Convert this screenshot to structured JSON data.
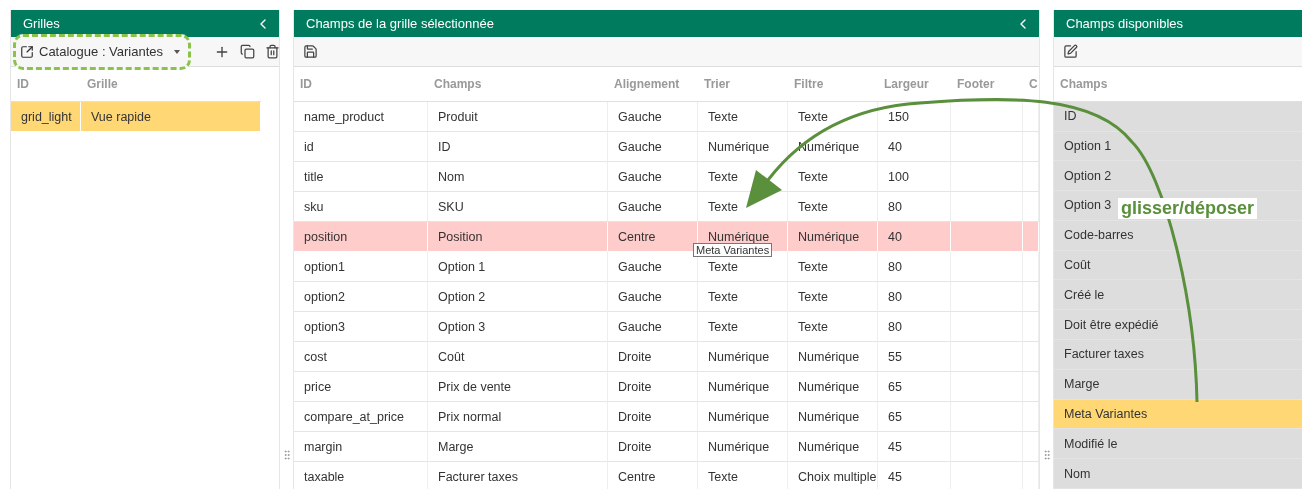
{
  "grids_panel": {
    "title": "Grilles",
    "selector": {
      "label": "Catalogue : Variantes"
    },
    "columns": [
      "ID",
      "Grille"
    ],
    "rows": [
      {
        "id": "grid_light",
        "name": "Vue rapide",
        "selected": true
      }
    ]
  },
  "fields_panel": {
    "title": "Champs de la grille sélectionnée",
    "columns": [
      "ID",
      "Champs",
      "Alignement",
      "Trier",
      "Filtre",
      "Largeur",
      "Footer",
      "C"
    ],
    "rows": [
      {
        "cells": [
          "name_product",
          "Produit",
          "Gauche",
          "Texte",
          "Texte",
          "150"
        ],
        "selected": false
      },
      {
        "cells": [
          "id",
          "ID",
          "Gauche",
          "Numérique",
          "Numérique",
          "40"
        ],
        "selected": false
      },
      {
        "cells": [
          "title",
          "Nom",
          "Gauche",
          "Texte",
          "Texte",
          "100"
        ],
        "selected": false
      },
      {
        "cells": [
          "sku",
          "SKU",
          "Gauche",
          "Texte",
          "Texte",
          "80"
        ],
        "selected": false
      },
      {
        "cells": [
          "position",
          "Position",
          "Centre",
          "Numérique",
          "Numérique",
          "40"
        ],
        "selected": true
      },
      {
        "cells": [
          "option1",
          "Option 1",
          "Gauche",
          "Texte",
          "Texte",
          "80"
        ],
        "selected": false
      },
      {
        "cells": [
          "option2",
          "Option 2",
          "Gauche",
          "Texte",
          "Texte",
          "80"
        ],
        "selected": false
      },
      {
        "cells": [
          "option3",
          "Option 3",
          "Gauche",
          "Texte",
          "Texte",
          "80"
        ],
        "selected": false
      },
      {
        "cells": [
          "cost",
          "Coût",
          "Droite",
          "Numérique",
          "Numérique",
          "55"
        ],
        "selected": false
      },
      {
        "cells": [
          "price",
          "Prix de vente",
          "Droite",
          "Numérique",
          "Numérique",
          "65"
        ],
        "selected": false
      },
      {
        "cells": [
          "compare_at_price",
          "Prix normal",
          "Droite",
          "Numérique",
          "Numérique",
          "65"
        ],
        "selected": false
      },
      {
        "cells": [
          "margin",
          "Marge",
          "Droite",
          "Numérique",
          "Numérique",
          "45"
        ],
        "selected": false
      },
      {
        "cells": [
          "taxable",
          "Facturer taxes",
          "Centre",
          "Texte",
          "Choix multiple",
          "45"
        ],
        "selected": false
      }
    ]
  },
  "available_panel": {
    "title": "Champs disponibles",
    "column": "Champs",
    "items": [
      {
        "label": "ID",
        "selected": false
      },
      {
        "label": "Option 1",
        "selected": false
      },
      {
        "label": "Option 2",
        "selected": false
      },
      {
        "label": "Option 3",
        "selected": false
      },
      {
        "label": "Code-barres",
        "selected": false
      },
      {
        "label": "Coût",
        "selected": false
      },
      {
        "label": "Créé le",
        "selected": false
      },
      {
        "label": "Doit être expédié",
        "selected": false
      },
      {
        "label": "Facturer taxes",
        "selected": false
      },
      {
        "label": "Marge",
        "selected": false
      },
      {
        "label": "Meta Variantes",
        "selected": true
      },
      {
        "label": "Modifié le",
        "selected": false
      },
      {
        "label": "Nom",
        "selected": false
      }
    ]
  },
  "drag_ghost": {
    "label": "Meta Variantes"
  },
  "annotation": {
    "label": "glisser/déposer"
  }
}
